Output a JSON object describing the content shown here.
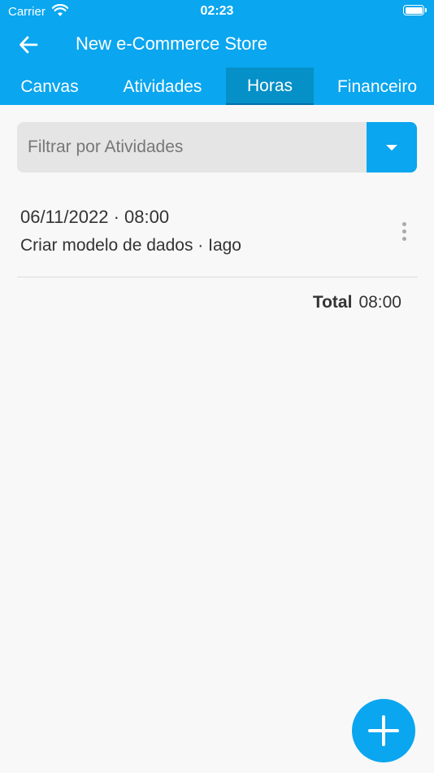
{
  "status_bar": {
    "carrier": "Carrier",
    "time": "02:23",
    "icons": [
      "wifi-icon",
      "battery-icon"
    ]
  },
  "header": {
    "title": "New e-Commerce Store",
    "back_icon": "arrow-left-icon"
  },
  "tabs": [
    {
      "label": "Canvas",
      "active": false
    },
    {
      "label": "Atividades",
      "active": false
    },
    {
      "label": "Horas",
      "active": true
    },
    {
      "label": "Financeiro",
      "active": false
    }
  ],
  "filter": {
    "placeholder": "Filtrar por Atividades",
    "dropdown_icon": "caret-down-icon"
  },
  "entries": [
    {
      "date_time": "06/11/2022 · 08:00",
      "description": "Criar modelo de dados · Iago",
      "menu_icon": "more-vertical-icon"
    }
  ],
  "total": {
    "label": "Total",
    "value": "08:00"
  },
  "fab": {
    "icon": "plus-icon"
  },
  "colors": {
    "primary": "#0aa6ef",
    "active_tab": "#0590c8",
    "background": "#f8f8f8"
  }
}
